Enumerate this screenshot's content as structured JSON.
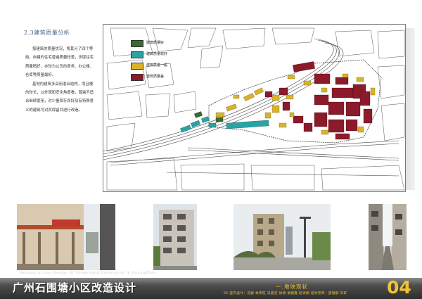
{
  "section": {
    "title": "2.3建筑质量分析",
    "paragraphs": [
      "按建筑的质量状况，将其分了四个等级，自建的住宅普遍质量较差，多层住宅质量稍好，亦较为公司的商务、办公楼、仓库等质量最好。",
      "基地内建筑多采用混合结构，而且楼的较长，以外观和安全角度看，普遍不适合继续使用，对少量保存良好及有特殊意义的建筑可对其保留并进行改造。"
    ]
  },
  "legend": [
    {
      "label": "建筑质量好",
      "color": "#3a6a2e"
    },
    {
      "label": "建筑质量较好",
      "color": "#2aa3a3"
    },
    {
      "label": "建筑质量一般",
      "color": "#d9b32a"
    },
    {
      "label": "建筑质量差",
      "color": "#8b1a2a"
    }
  ],
  "photos": [
    {
      "name": "photo-apartment-corridor"
    },
    {
      "name": "photo-residential-block"
    },
    {
      "name": "photo-street-building"
    },
    {
      "name": "photo-narrow-alley"
    }
  ],
  "footer": {
    "subtitle": "Reconstruction Design Of Shiweitang Community In GuangZhou",
    "title": "广州石围塘小区改造设计",
    "section": "一.地块现状",
    "credits": "05 室内设计：冯群  林伟旺  冯嘉咨  徐倩  谢振鑫  赵诗娟     指导老师：邵丽群  刘轩",
    "page_number": "04"
  },
  "colors": {
    "good": "#3a6a2e",
    "fair": "#2aa3a3",
    "average": "#d9b32a",
    "poor": "#8b1a2a",
    "accent": "#f1c232"
  }
}
